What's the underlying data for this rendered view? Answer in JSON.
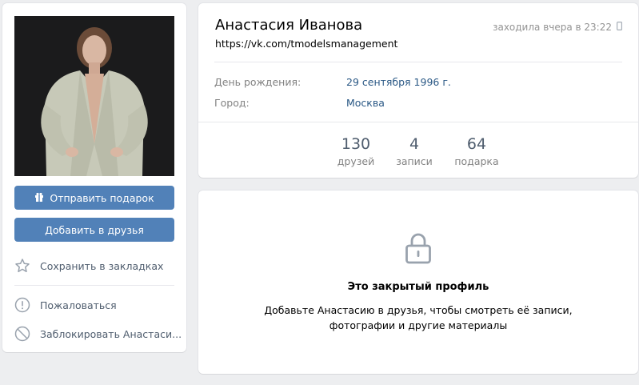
{
  "sidebar": {
    "gift_button": "Отправить подарок",
    "add_friend_button": "Добавить в друзья",
    "bookmark": "Сохранить в закладках",
    "report": "Пожаловаться",
    "block": "Заблокировать Анастаси..."
  },
  "profile": {
    "name": "Анастасия Иванова",
    "url": "https://vk.com/tmodelsmanagement",
    "last_seen": "заходила вчера в 23:22",
    "birthday_label": "День рождения:",
    "birthday_value": "29 сентября 1996 г.",
    "city_label": "Город:",
    "city_value": "Москва"
  },
  "counters": [
    {
      "value": "130",
      "label": "друзей"
    },
    {
      "value": "4",
      "label": "записи"
    },
    {
      "value": "64",
      "label": "подарка"
    }
  ],
  "closed": {
    "title": "Это закрытый профиль",
    "text": "Добавьте Анастасию в друзья, чтобы смотреть её записи, фотографии и другие материалы"
  },
  "icons": {
    "gift": "gift-icon",
    "star": "star-icon",
    "report": "exclamation-icon",
    "block": "block-icon",
    "lock": "lock-icon",
    "phone": "mobile-icon"
  },
  "colors": {
    "accent": "#5181b8",
    "link": "#2a5885",
    "background": "#edeef0"
  }
}
